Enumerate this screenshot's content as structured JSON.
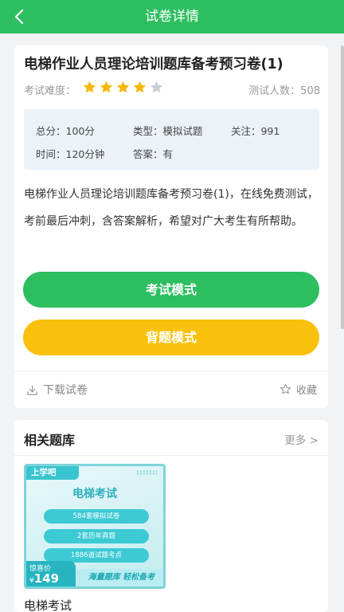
{
  "header": {
    "title": "试卷详情"
  },
  "exam": {
    "title": "电梯作业人员理论培训题库备考预习卷(1)",
    "difficulty_label": "考试难度：",
    "rating": {
      "filled": 4,
      "total": 5
    },
    "testers_text": "测试人数：508",
    "info": {
      "total": "总分：100分",
      "type": "类型：模拟试题",
      "follow": "关注：991",
      "time": "时间：120分钟",
      "answer": "答案：有"
    },
    "description": "电梯作业人员理论培训题库备考预习卷(1)，在线免费测试，考前最后冲刺，含答案解析，希望对广大考生有所帮助。",
    "buttons": {
      "exam_mode": "考试模式",
      "memorize_mode": "背题模式"
    },
    "download_label": "下载试卷",
    "favorite_label": "收藏"
  },
  "related": {
    "title": "相关题库",
    "more": "更多 >",
    "items": [
      {
        "logo": "上学吧",
        "cover_title": "电梯考试",
        "pills": [
          "584套模拟试卷",
          "2套历年真题",
          "1886道试题考点"
        ],
        "price_label": "惊喜价",
        "price_currency": "¥",
        "price": "149",
        "slogan": "海量题库 轻松备考",
        "name": "电梯考试"
      }
    ]
  },
  "colors": {
    "primary": "#2dbe60",
    "accent": "#f9c10c",
    "teal": "#38c5cf"
  }
}
